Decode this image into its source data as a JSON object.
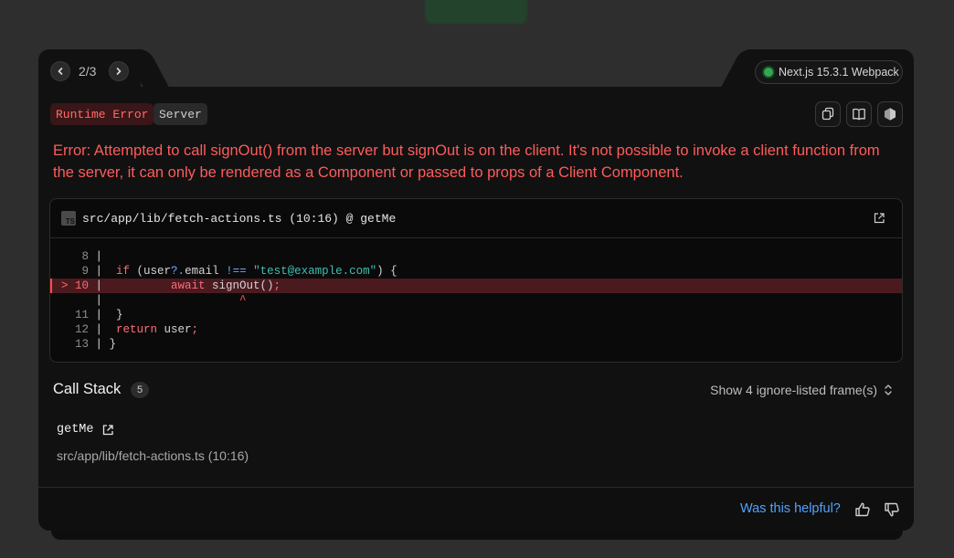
{
  "nav": {
    "position": "2/3"
  },
  "version": {
    "label": "Next.js 15.3.1 Webpack",
    "status_color": "#32a852"
  },
  "badges": {
    "runtime": "Runtime Error",
    "server": "Server"
  },
  "toolbar": {
    "icons": [
      "copy-icon",
      "docs-book-icon",
      "nodejs-hexagon-icon"
    ]
  },
  "error": {
    "message": "Error: Attempted to call signOut() from the server but signOut is on the client. It's not possible to invoke a client function from the server, it can only be rendered as a Component or passed to props of a Client Component."
  },
  "code_frame": {
    "file": "src/app/lib/fetch-actions.ts (10:16) @ getMe",
    "lines": [
      {
        "n": "8",
        "text": ""
      },
      {
        "n": "9",
        "text": "  if (user?.email !== \"test@example.com\") {"
      },
      {
        "n": "10",
        "text": "          await signOut();",
        "highlighted": true,
        "marker": ">"
      },
      {
        "n": "",
        "text": "                    ^"
      },
      {
        "n": "11",
        "text": "  }"
      },
      {
        "n": "12",
        "text": "  return user;"
      },
      {
        "n": "13",
        "text": "}"
      }
    ]
  },
  "call_stack": {
    "title": "Call Stack",
    "count": "5",
    "show_ignored": "Show 4 ignore-listed frame(s)",
    "frames": [
      {
        "fn": "getMe",
        "location": "src/app/lib/fetch-actions.ts (10:16)"
      }
    ]
  },
  "footer": {
    "helpful": "Was this helpful?"
  },
  "colors": {
    "error": "#ff5b5b",
    "accent": "#4fa3ff",
    "background": "#111111"
  }
}
